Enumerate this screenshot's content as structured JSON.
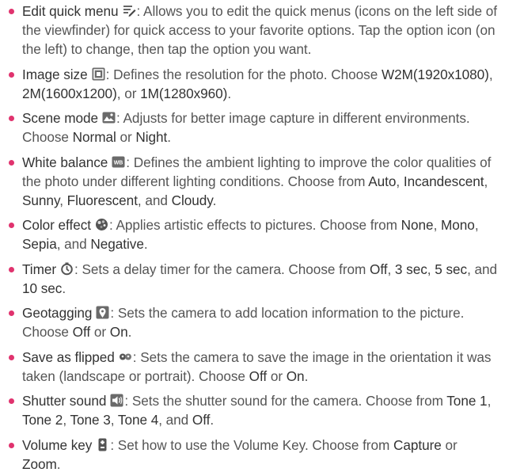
{
  "colors": {
    "bullet": "#e0336e",
    "text": "#555555",
    "title": "#333333",
    "icon": "#5a5a5a"
  },
  "items": [
    {
      "title": "Edit quick menu",
      "icon": "edit-quick-menu-icon",
      "segs": [
        {
          "t": ": Allows you to edit the quick menus (icons on the left side of the viewfinder) for quick access to your favorite options. Tap the option icon (on the left) to change, then tap the option you want.",
          "o": false
        }
      ]
    },
    {
      "title": "Image size",
      "icon": "image-size-icon",
      "segs": [
        {
          "t": ": Defines the resolution for the photo. Choose ",
          "o": false
        },
        {
          "t": "W2M(1920x1080)",
          "o": true
        },
        {
          "t": ", ",
          "o": false
        },
        {
          "t": "2M(1600x1200)",
          "o": true
        },
        {
          "t": ", or ",
          "o": false
        },
        {
          "t": "1M(1280x960)",
          "o": true
        },
        {
          "t": ".",
          "o": false
        }
      ]
    },
    {
      "title": "Scene mode",
      "icon": "scene-mode-icon",
      "segs": [
        {
          "t": ": Adjusts for better image capture in different environments. Choose ",
          "o": false
        },
        {
          "t": "Normal",
          "o": true
        },
        {
          "t": " or ",
          "o": false
        },
        {
          "t": "Night",
          "o": true
        },
        {
          "t": ".",
          "o": false
        }
      ]
    },
    {
      "title": "White balance",
      "icon": "white-balance-icon",
      "segs": [
        {
          "t": ": Defines the ambient lighting to improve the color qualities of the photo under different lighting conditions. Choose from ",
          "o": false
        },
        {
          "t": "Auto",
          "o": true
        },
        {
          "t": ", ",
          "o": false
        },
        {
          "t": "Incandescent",
          "o": true
        },
        {
          "t": ", ",
          "o": false
        },
        {
          "t": "Sunny",
          "o": true
        },
        {
          "t": ", ",
          "o": false
        },
        {
          "t": "Fluorescent",
          "o": true
        },
        {
          "t": ", and ",
          "o": false
        },
        {
          "t": "Cloudy",
          "o": true
        },
        {
          "t": ".",
          "o": false
        }
      ]
    },
    {
      "title": "Color effect",
      "icon": "color-effect-icon",
      "segs": [
        {
          "t": ": Applies artistic effects to pictures. Choose from ",
          "o": false
        },
        {
          "t": "None",
          "o": true
        },
        {
          "t": ", ",
          "o": false
        },
        {
          "t": "Mono",
          "o": true
        },
        {
          "t": ", ",
          "o": false
        },
        {
          "t": "Sepia",
          "o": true
        },
        {
          "t": ", and ",
          "o": false
        },
        {
          "t": "Negative",
          "o": true
        },
        {
          "t": ".",
          "o": false
        }
      ]
    },
    {
      "title": "Timer",
      "icon": "timer-icon",
      "segs": [
        {
          "t": ": Sets a delay timer for the camera. Choose from ",
          "o": false
        },
        {
          "t": "Off",
          "o": true
        },
        {
          "t": ", ",
          "o": false
        },
        {
          "t": "3 sec",
          "o": true
        },
        {
          "t": ", ",
          "o": false
        },
        {
          "t": "5 sec",
          "o": true
        },
        {
          "t": ", and ",
          "o": false
        },
        {
          "t": "10 sec",
          "o": true
        },
        {
          "t": ".",
          "o": false
        }
      ]
    },
    {
      "title": "Geotagging",
      "icon": "geotagging-icon",
      "segs": [
        {
          "t": ": Sets the camera to add location information to the picture. Choose ",
          "o": false
        },
        {
          "t": "Off",
          "o": true
        },
        {
          "t": " or ",
          "o": false
        },
        {
          "t": "On",
          "o": true
        },
        {
          "t": ".",
          "o": false
        }
      ]
    },
    {
      "title": "Save as flipped",
      "icon": "save-as-flipped-icon",
      "segs": [
        {
          "t": ": Sets the camera to save the image in the orientation it was taken (landscape or portrait). Choose ",
          "o": false
        },
        {
          "t": "Off",
          "o": true
        },
        {
          "t": " or ",
          "o": false
        },
        {
          "t": "On",
          "o": true
        },
        {
          "t": ".",
          "o": false
        }
      ]
    },
    {
      "title": "Shutter sound",
      "icon": "shutter-sound-icon",
      "segs": [
        {
          "t": ": Sets the shutter sound for the camera. Choose from ",
          "o": false
        },
        {
          "t": "Tone 1",
          "o": true
        },
        {
          "t": ", ",
          "o": false
        },
        {
          "t": "Tone 2",
          "o": true
        },
        {
          "t": ", ",
          "o": false
        },
        {
          "t": "Tone 3",
          "o": true
        },
        {
          "t": ", ",
          "o": false
        },
        {
          "t": "Tone 4",
          "o": true
        },
        {
          "t": ", and ",
          "o": false
        },
        {
          "t": "Off",
          "o": true
        },
        {
          "t": ".",
          "o": false
        }
      ]
    },
    {
      "title": "Volume key",
      "icon": "volume-key-icon",
      "segs": [
        {
          "t": ": Set how to use the Volume Key. Choose from ",
          "o": false
        },
        {
          "t": "Capture",
          "o": true
        },
        {
          "t": " or ",
          "o": false
        },
        {
          "t": "Zoom",
          "o": true
        },
        {
          "t": ".",
          "o": false
        }
      ]
    }
  ]
}
